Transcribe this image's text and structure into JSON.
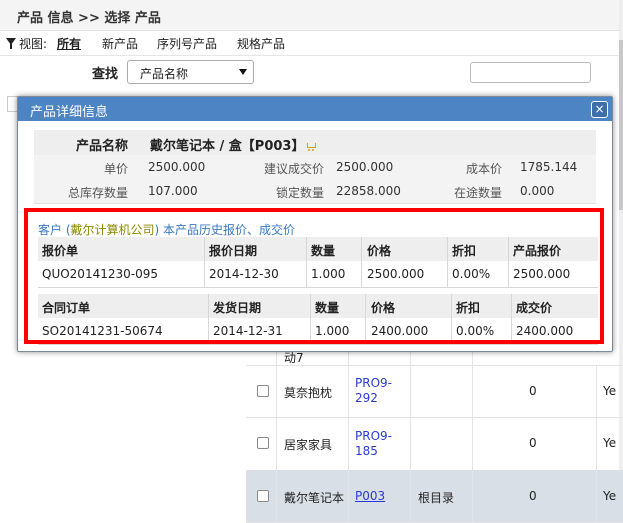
{
  "page": {
    "title": "产品 信息 >> 选择 产品"
  },
  "view_bar": {
    "label": "视图:",
    "items": [
      "所有",
      "新产品",
      "序列号产品",
      "规格产品"
    ]
  },
  "search": {
    "label": "查找",
    "field_selected": "产品名称",
    "input_value": ""
  },
  "background_rows": [
    {
      "name": "动7",
      "code": "",
      "dir": "",
      "num": "",
      "yes": ""
    },
    {
      "name": "莫奈抱枕",
      "code_line1": "PRO9-",
      "code_line2": "292",
      "num": "0",
      "yes": "Ye"
    },
    {
      "name": "居家家具",
      "code_line1": "PRO9-",
      "code_line2": "185",
      "num": "0",
      "yes": "Ye"
    },
    {
      "name": "戴尔笔记本",
      "code": "P003",
      "dir": "根目录",
      "num": "0",
      "yes": "Ye"
    }
  ],
  "dialog": {
    "title": "产品详细信息",
    "close_label": "×",
    "product_name_label": "产品名称",
    "product_name_value": "戴尔笔记本 / 盒【P003】",
    "unit_price_label": "单价",
    "unit_price_value": "2500.000",
    "suggested_price_label": "建议成交价",
    "suggested_price_value": "2500.000",
    "cost_label": "成本价",
    "cost_value": "1785.144",
    "stock_label": "总库存数量",
    "stock_value": "107.000",
    "locked_label": "锁定数量",
    "locked_value": "22858.000",
    "transit_label": "在途数量",
    "transit_value": "0.000",
    "history": {
      "prefix": "客户 (",
      "customer": "戴尔计算机公司",
      "suffix": ") 本产品历史报价、成交价"
    },
    "quote_table": {
      "headers": [
        "报价单",
        "报价日期",
        "数量",
        "价格",
        "折扣",
        "产品报价"
      ],
      "row": [
        "QUO20141230-095",
        "2014-12-30",
        "1.000",
        "2500.000",
        "0.00%",
        "2500.000"
      ]
    },
    "order_table": {
      "headers": [
        "合同订单",
        "发货日期",
        "数量",
        "价格",
        "折扣",
        "成交价"
      ],
      "row": [
        "SO20141231-50674",
        "2014-12-31",
        "1.000",
        "2400.000",
        "0.00%",
        "2400.000"
      ]
    }
  }
}
